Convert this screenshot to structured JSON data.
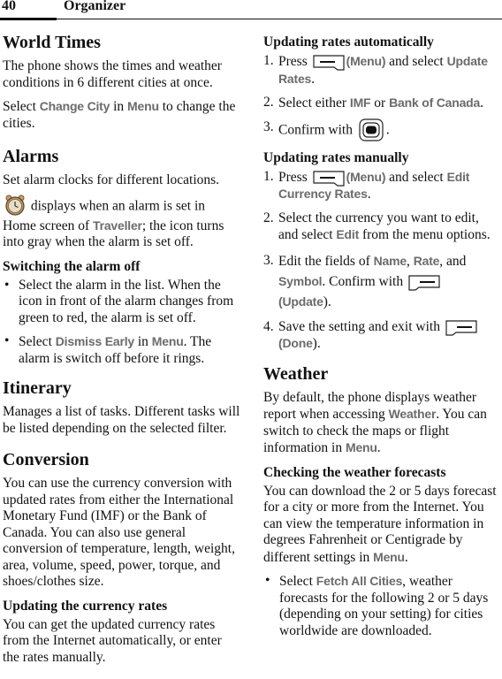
{
  "header": {
    "page_number": "40",
    "chapter": "Organizer"
  },
  "left": {
    "world_times": {
      "title": "World Times",
      "p1": "The phone shows the times and weather conditions in 6 different cities at once.",
      "p2": {
        "pre": "Select ",
        "ui1": "Change City",
        "mid": " in ",
        "ui2": "Menu",
        "post": " to change the cities."
      }
    },
    "alarms": {
      "title": "Alarms",
      "p1": "Set alarm clocks for different locations.",
      "p2": {
        "icon": "alarm-clock-icon",
        "pre": " displays when an alarm is set in Home screen of ",
        "ui1": "Traveller",
        "post": "; the icon turns into gray when the alarm is set off."
      },
      "subtitle": "Switching the alarm off",
      "bullets": [
        {
          "text": "Select the alarm in the list. When the icon in front of the alarm changes from green to red, the alarm is set off."
        },
        {
          "pre": "Select ",
          "ui1": "Dismiss Early",
          "mid": " in ",
          "ui2": "Menu",
          "post": ". The alarm is switch off before it rings."
        }
      ]
    },
    "itinerary": {
      "title": "Itinerary",
      "p1": "Manages a list of tasks. Different tasks will be listed depending on the selected filter."
    },
    "conversion": {
      "title": "Conversion",
      "p1": "You can use the currency conversion with updated rates from either the International Monetary Fund (IMF) or the Bank of Canada. You can also use general conversion of temperature, length, weight, area, volume, speed, power, torque, and shoes/clothes size.",
      "subtitle": "Updating the currency rates",
      "p2": "You can get the updated currency rates from the Internet automatically, or enter the rates manually."
    }
  },
  "right": {
    "auto": {
      "title": "Updating rates automatically",
      "steps": [
        {
          "num": "1.",
          "pre": "Press ",
          "key": "left-softkey-icon",
          "ui1": "(Menu)",
          "mid": " and select ",
          "ui2": "Update Rates",
          "post": "."
        },
        {
          "num": "2.",
          "pre": "Select either ",
          "ui1": "IMF",
          "mid": " or ",
          "ui2": "Bank of Canada",
          "post": "."
        },
        {
          "num": "3.",
          "pre": "Confirm with ",
          "key": "ok-key-icon",
          "post": "."
        }
      ]
    },
    "manual": {
      "title": "Updating rates manually",
      "steps": [
        {
          "num": "1.",
          "pre": "Press ",
          "key": "left-softkey-icon",
          "ui1": "(Menu)",
          "mid": " and select ",
          "ui2": "Edit Currency Rates",
          "post": "."
        },
        {
          "num": "2.",
          "pre": "Select the currency you want to edit, and select ",
          "ui1": "Edit",
          "post": " from the menu options."
        },
        {
          "num": "3.",
          "pre": "Edit the fields of ",
          "ui1": "Name",
          "sep1": ", ",
          "ui2": "Rate",
          "sep2": ", and ",
          "ui3": "Symbol",
          "mid": ". Confirm with ",
          "key": "right-softkey-icon",
          "ui4": "Update",
          "post": ")."
        },
        {
          "num": "4.",
          "pre": "Save the setting and exit with ",
          "key": "right-softkey-icon",
          "ui1": "Done",
          "post": ")."
        }
      ]
    },
    "weather": {
      "title": "Weather",
      "p1": {
        "pre": "By default, the phone displays weather report when accessing ",
        "ui1": "Weather",
        "mid": ". You can switch to check the maps or flight information in ",
        "ui2": "Menu",
        "post": "."
      },
      "subtitle": "Checking the weather forecasts",
      "p2": {
        "pre": "You can download the 2 or 5 days forecast for a city or more from the Internet. You can view the temperature information in degrees Fahrenheit or Centigrade by different settings in ",
        "ui1": "Menu",
        "post": "."
      },
      "bullets": [
        {
          "pre": "Select ",
          "ui1": "Fetch All Cities",
          "post": ", weather forecasts for the following 2 or 5 days (depending on your setting) for cities worldwide are downloaded."
        }
      ]
    }
  }
}
